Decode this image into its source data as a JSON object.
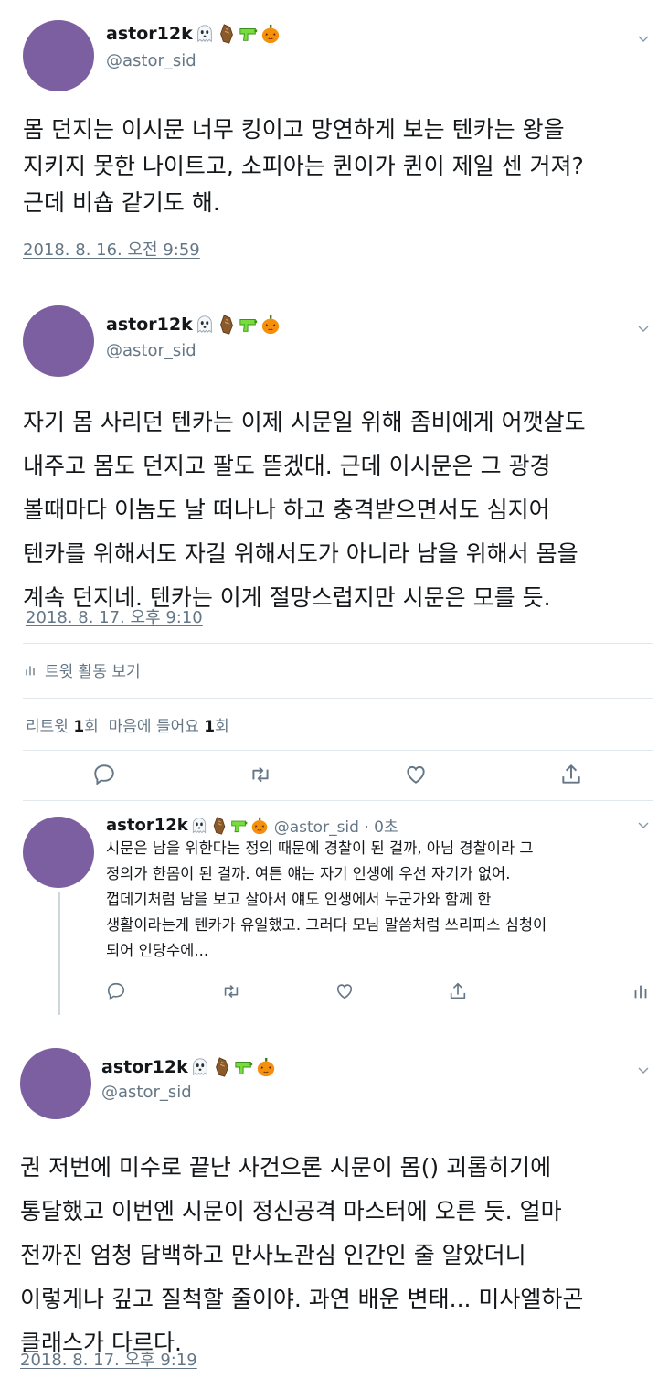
{
  "author": {
    "name": "astor12k",
    "handle": "@astor_sid",
    "emojis": [
      "ghost-emoji",
      "coffin-emoji",
      "water-pistol-emoji",
      "jack-o-lantern-emoji"
    ],
    "avatar_color": "#7b5fa0"
  },
  "tweets": [
    {
      "text": "몸 던지는 이시문 너무 킹이고 망연하게 보는 텐카는 왕을\n지키지 못한 나이트고, 소피아는 퀸이가 퀸이 제일 센 거져?\n근데 비숍 같기도 해.",
      "timestamp": "2018. 8. 16. 오전 9:59"
    },
    {
      "text": "자기 몸 사리던 텐카는 이제 시문일 위해 좀비에게 어깻살도\n내주고 몸도 던지고 팔도 뜯겠대. 근데 이시문은 그 광경\n볼때마다 이놈도 날 떠나나 하고 충격받으면서도 심지어\n텐카를 위해서도 자길 위해서도가 아니라 남을 위해서 몸을\n계속 던지네. 텐카는 이게 절망스럽지만 시문은 모를 듯.",
      "timestamp": "2018. 8. 17. 오후 9:10",
      "activity_label": "트윗 활동 보기",
      "stats": {
        "retweet_label": "리트윗",
        "retweet_count": "1",
        "retweet_unit": "회",
        "like_label": "마음에 들어요",
        "like_count": "1",
        "like_unit": "회"
      }
    },
    {
      "text": "권 저번에 미수로 끝난 사건으론 시문이 몸() 괴롭히기에\n통달했고 이번엔 시문이 정신공격 마스터에 오른 듯. 얼마\n전까진 엄청 담백하고 만사노관심 인간인 줄 알았더니\n이렇게나 깊고 질척할 줄이야. 과연 배운 변태... 미사엘하곤\n클래스가 다르다.",
      "timestamp": "2018. 8. 17. 오후 9:19"
    }
  ],
  "reply": {
    "meta": "@astor_sid · 0초",
    "text": "시문은 남을 위한다는 정의 때문에 경찰이 된 걸까, 아님 경찰이라 그\n정의가 한몸이 된 걸까. 여튼 얘는 자기 인생에 우선 자기가 없어.\n껍데기처럼 남을 보고 살아서 얘도 인생에서 누군가와 함께 한\n생활이라는게 텐카가 유일했고. 그러다 모님 말씀처럼 쓰리피스 심청이\n되어 인당수에..."
  },
  "colors": {
    "text": "#14171a",
    "secondary": "#657786",
    "divider": "#e1e8ed",
    "avatar": "#7b5fa0"
  }
}
